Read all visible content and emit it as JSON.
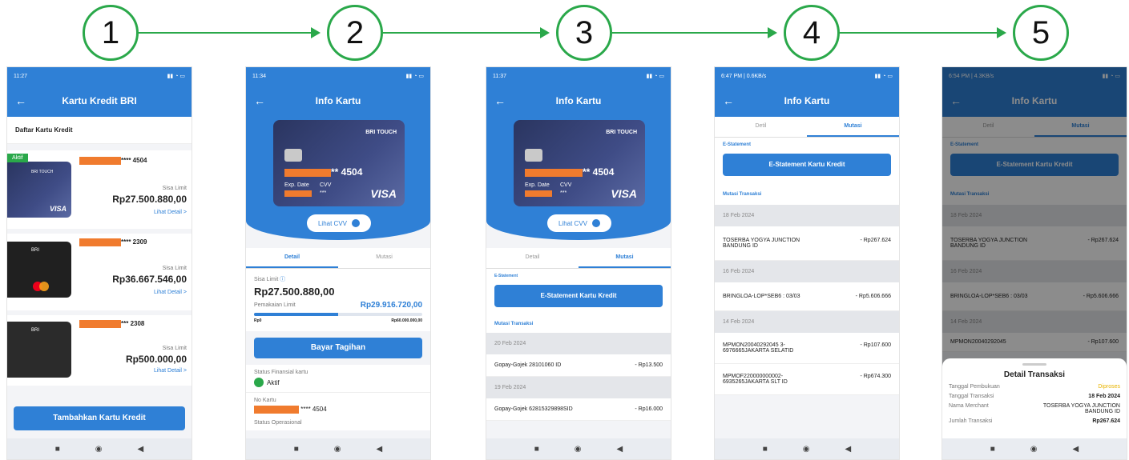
{
  "steps": [
    "1",
    "2",
    "3",
    "4",
    "5"
  ],
  "colors": {
    "accent": "#2aa84a",
    "brand": "#2f80d6",
    "highlight": "#f07b2e"
  },
  "screen1": {
    "status_time": "11:27",
    "title": "Kartu Kredit BRI",
    "section": "Daftar Kartu Kredit",
    "badge": "Aktif",
    "cards": [
      {
        "number": "**** 4504",
        "limit_label": "Sisa Limit",
        "limit": "Rp27.500.880,00",
        "detail": "Lihat Detail  >",
        "brand_top": "BRI TOUCH",
        "network": "VISA"
      },
      {
        "number": "**** 2309",
        "limit_label": "Sisa Limit",
        "limit": "Rp36.667.546,00",
        "detail": "Lihat Detail  >",
        "brand_top": "BRI",
        "network": ""
      },
      {
        "number": "*** 2308",
        "limit_label": "Sisa Limit",
        "limit": "Rp500.000,00",
        "detail": "Lihat Detail  >",
        "brand_top": "BRI",
        "network": ""
      }
    ],
    "add_button": "Tambahkan Kartu Kredit"
  },
  "screen2": {
    "status_time": "11:34",
    "title": "Info Kartu",
    "card_brand": "BRI TOUCH",
    "card_number": "** 4504",
    "exp_label": "Exp. Date",
    "cvv_label": "CVV",
    "cvv_mask": "***",
    "network": "VISA",
    "cvv_button": "Lihat CVV",
    "tab_detail": "Detail",
    "tab_mutasi": "Mutasi",
    "sisa_label": "Sisa Limit",
    "sisa_value": "Rp27.500.880,00",
    "pemakaian_label": "Pemakaian Limit",
    "pemakaian_value": "Rp29.916.720,00",
    "range_min": "Rp0",
    "range_max": "Rp60.000.000,00",
    "usage_fraction": 0.5,
    "pay_button": "Bayar Tagihan",
    "status_label": "Status Finansial kartu",
    "status_value": "Aktif",
    "no_label": "No Kartu",
    "no_value": "**** 4504",
    "cut_label": "Status Operasional"
  },
  "screen3": {
    "status_time": "11:37",
    "title": "Info Kartu",
    "card_brand": "BRI TOUCH",
    "card_number": "** 4504",
    "exp_label": "Exp. Date",
    "cvv_label": "CVV",
    "cvv_mask": "***",
    "network": "VISA",
    "cvv_button": "Lihat CVV",
    "tab_detail": "Detail",
    "tab_mutasi": "Mutasi",
    "estatement_label": "E-Statement",
    "estatement_button": "E-Statement Kartu Kredit",
    "mutasi_label": "Mutasi Transaksi",
    "groups": [
      {
        "date": "20 Feb 2024",
        "desc": "Gopay-Gojek 28101060 ID",
        "amount": "- Rp13.500"
      },
      {
        "date": "19 Feb 2024",
        "desc": "Gopay-Gojek 62815329898SID",
        "amount": "- Rp16.000"
      }
    ]
  },
  "screen4": {
    "status_time": "6:47 PM | 0.6KB/s",
    "title": "Info Kartu",
    "tab_detail": "Detil",
    "tab_mutasi": "Mutasi",
    "estatement_label": "E-Statement",
    "estatement_button": "E-Statement Kartu Kredit",
    "mutasi_label": "Mutasi Transaksi",
    "groups": [
      {
        "date": "18 Feb 2024",
        "desc": "TOSERBA YOGYA JUNCTION BANDUNG ID",
        "amount": "- Rp267.624"
      },
      {
        "date": "16 Feb 2024",
        "desc": "BRINGLOA-LOP*SEB6 : 03/03",
        "amount": "- Rp5.606.666"
      },
      {
        "date": "14 Feb 2024",
        "desc": "MPMON20040292045 3-6976665JAKARTA SELATID",
        "amount": "- Rp107.600"
      },
      {
        "date": "",
        "desc": "MPMOF220000000002- 6935265JAKARTA SLT ID",
        "amount": "- Rp674.300"
      }
    ]
  },
  "screen5": {
    "status_time": "6:54 PM | 4.3KB/s",
    "title": "Info Kartu",
    "tab_detail": "Detil",
    "tab_mutasi": "Mutasi",
    "estatement_label": "E-Statement",
    "estatement_button": "E-Statement Kartu Kredit",
    "mutasi_label": "Mutasi Transaksi",
    "bg_rows": [
      {
        "date": "18 Feb 2024",
        "desc": "TOSERBA YOGYA JUNCTION BANDUNG ID",
        "amount": "- Rp267.624"
      },
      {
        "date": "16 Feb 2024",
        "desc": "BRINGLOA-LOP*SEB6 : 03/03",
        "amount": "- Rp5.606.666"
      },
      {
        "date": "14 Feb 2024",
        "desc": "MPMON20040292045",
        "amount": "- Rp107.600"
      }
    ],
    "sheet_title": "Detail Transaksi",
    "fields": [
      {
        "label": "Tanggal Pembukuan",
        "value": "Diproses"
      },
      {
        "label": "Tanggal Transaksi",
        "value": "18 Feb 2024"
      },
      {
        "label": "Nama Merchant",
        "value": "TOSERBA YOGYA JUNCTION BANDUNG ID"
      },
      {
        "label": "Jumlah Transaksi",
        "value": "Rp267.624"
      }
    ]
  },
  "nav": {
    "square": "■",
    "circle": "◉",
    "back": "◀"
  }
}
